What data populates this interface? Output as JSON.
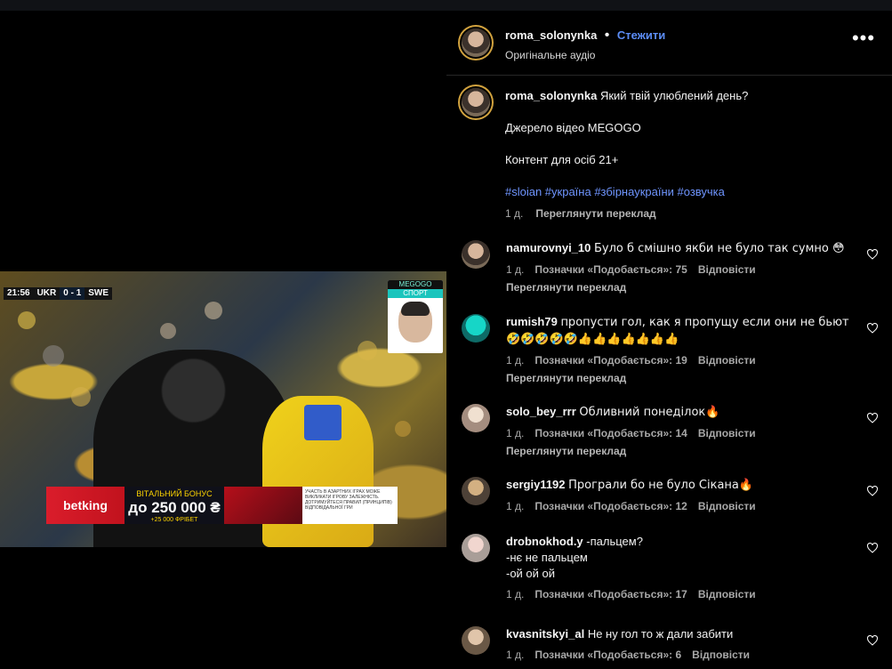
{
  "video": {
    "scorebug": {
      "time": "21:56",
      "home": "UKR",
      "score": "0 - 1",
      "away": "SWE"
    },
    "watermark": {
      "brand": "MEGOGO",
      "channel": "СПОРТ"
    },
    "ad": {
      "brand": "betking",
      "bonus_label": "ВІТАЛЬНИЙ БОНУС",
      "bonus_prefix": "до",
      "bonus_amount": "250 000 ₴",
      "bonus_extra": "+25 000 ФРІБЕТ",
      "fine_print": "УЧАСТЬ В АЗАРТНИХ ІГРАХ МОЖЕ ВИКЛИКАТИ ІГРОВУ ЗАЛЕЖНІСТЬ. ДОТРИМУЙТЕСЯ ПРАВИЛ (ПРИНЦИПІВ) ВІДПОВІДАЛЬНОЇ ГРИ"
    }
  },
  "post": {
    "username": "roma_solonynka",
    "separator": "•",
    "follow_label": "Стежити",
    "audio_label": "Оригінальне аудіо",
    "more_label": "•••",
    "caption": {
      "main": "Який твій улюблений день?",
      "line2": "Джерело відео MEGOGO",
      "line3": "Контент для осіб 21+",
      "hashtags": "#sloian #україна #збірнаукраїни #озвучка",
      "age": "1 д.",
      "translate": "Переглянути переклад"
    }
  },
  "comments": [
    {
      "username": "namurovnyi_10",
      "text": "Було б смішно якби не було так сумно 😳",
      "age": "1 д.",
      "likes": "Позначки «Подобається»: 75",
      "reply": "Відповісти",
      "translate": "Переглянути переклад"
    },
    {
      "username": "rumish79",
      "text": "пропусти гол, как я пропущу если они не бьют🤣🤣🤣🤣🤣👍👍👍👍👍👍👍",
      "age": "1 д.",
      "likes": "Позначки «Подобається»: 19",
      "reply": "Відповісти",
      "translate": "Переглянути переклад"
    },
    {
      "username": "solo_bey_rrr",
      "text": "Обливний понеділок🔥",
      "age": "1 д.",
      "likes": "Позначки «Подобається»: 14",
      "reply": "Відповісти",
      "translate": "Переглянути переклад"
    },
    {
      "username": "sergiy1192",
      "text": "Програли бо не було Сікана🔥",
      "age": "1 д.",
      "likes": "Позначки «Подобається»: 12",
      "reply": "Відповісти"
    },
    {
      "username": "drobnokhod.y",
      "line1": "-пальцем?",
      "line2": "-нє не пальцем",
      "line3": "-ой ой ой",
      "age": "1 д.",
      "likes": "Позначки «Подобається»: 17",
      "reply": "Відповісти"
    },
    {
      "username": "kvasnitskyi_al",
      "text": "Не ну гол то ж дали забити",
      "age": "1 д.",
      "likes": "Позначки «Подобається»: 6",
      "reply": "Відповісти"
    }
  ],
  "colors": {
    "accent": "#5c8df6",
    "hashtag": "#6f95ff",
    "ring": "#d1a23e"
  },
  "icons": {
    "more": "more-icon",
    "like": "heart-icon"
  }
}
